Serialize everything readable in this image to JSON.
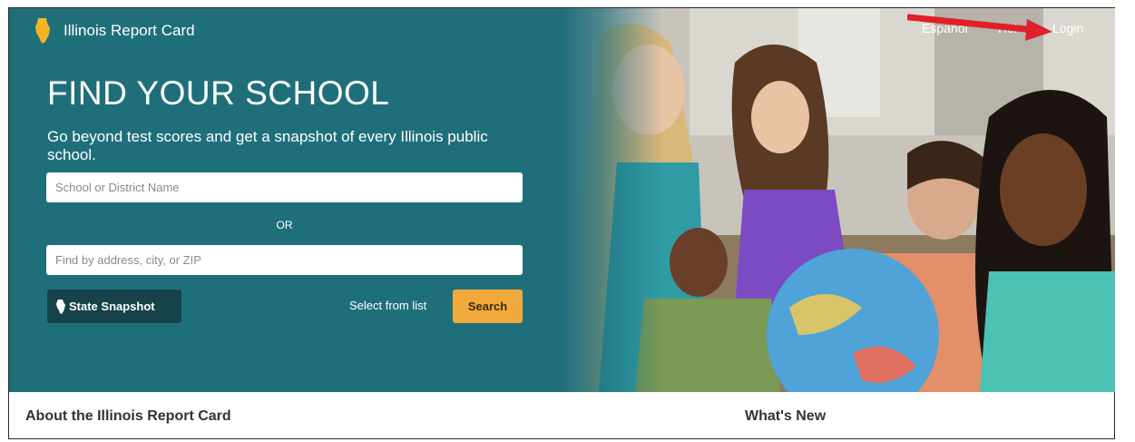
{
  "header": {
    "brand_name": "Illinois Report Card",
    "nav": {
      "espanol": "Español",
      "help": "Hel",
      "login": "Login"
    }
  },
  "hero": {
    "title": "FIND YOUR SCHOOL",
    "subtitle": "Go beyond test scores and get a snapshot of every Illinois public school.",
    "school_input": {
      "placeholder": "School or District Name",
      "value": ""
    },
    "or_label": "OR",
    "address_input": {
      "placeholder": "Find by address, city, or ZIP",
      "value": ""
    },
    "state_snapshot_label": "State Snapshot",
    "select_from_list_label": "Select from list",
    "search_label": "Search"
  },
  "sections": {
    "about_heading": "About the Illinois Report Card",
    "whats_new_heading": "What's New"
  },
  "icons": {
    "brand_logo": "illinois-state-icon",
    "snapshot": "illinois-state-icon",
    "annotation": "red-arrow-icon"
  },
  "colors": {
    "hero_bg": "#1f6f7b",
    "snapshot_button": "#16424a",
    "search_button": "#f0a93a",
    "brand_logo": "#f5b324",
    "annotation_arrow": "#e0202a"
  }
}
